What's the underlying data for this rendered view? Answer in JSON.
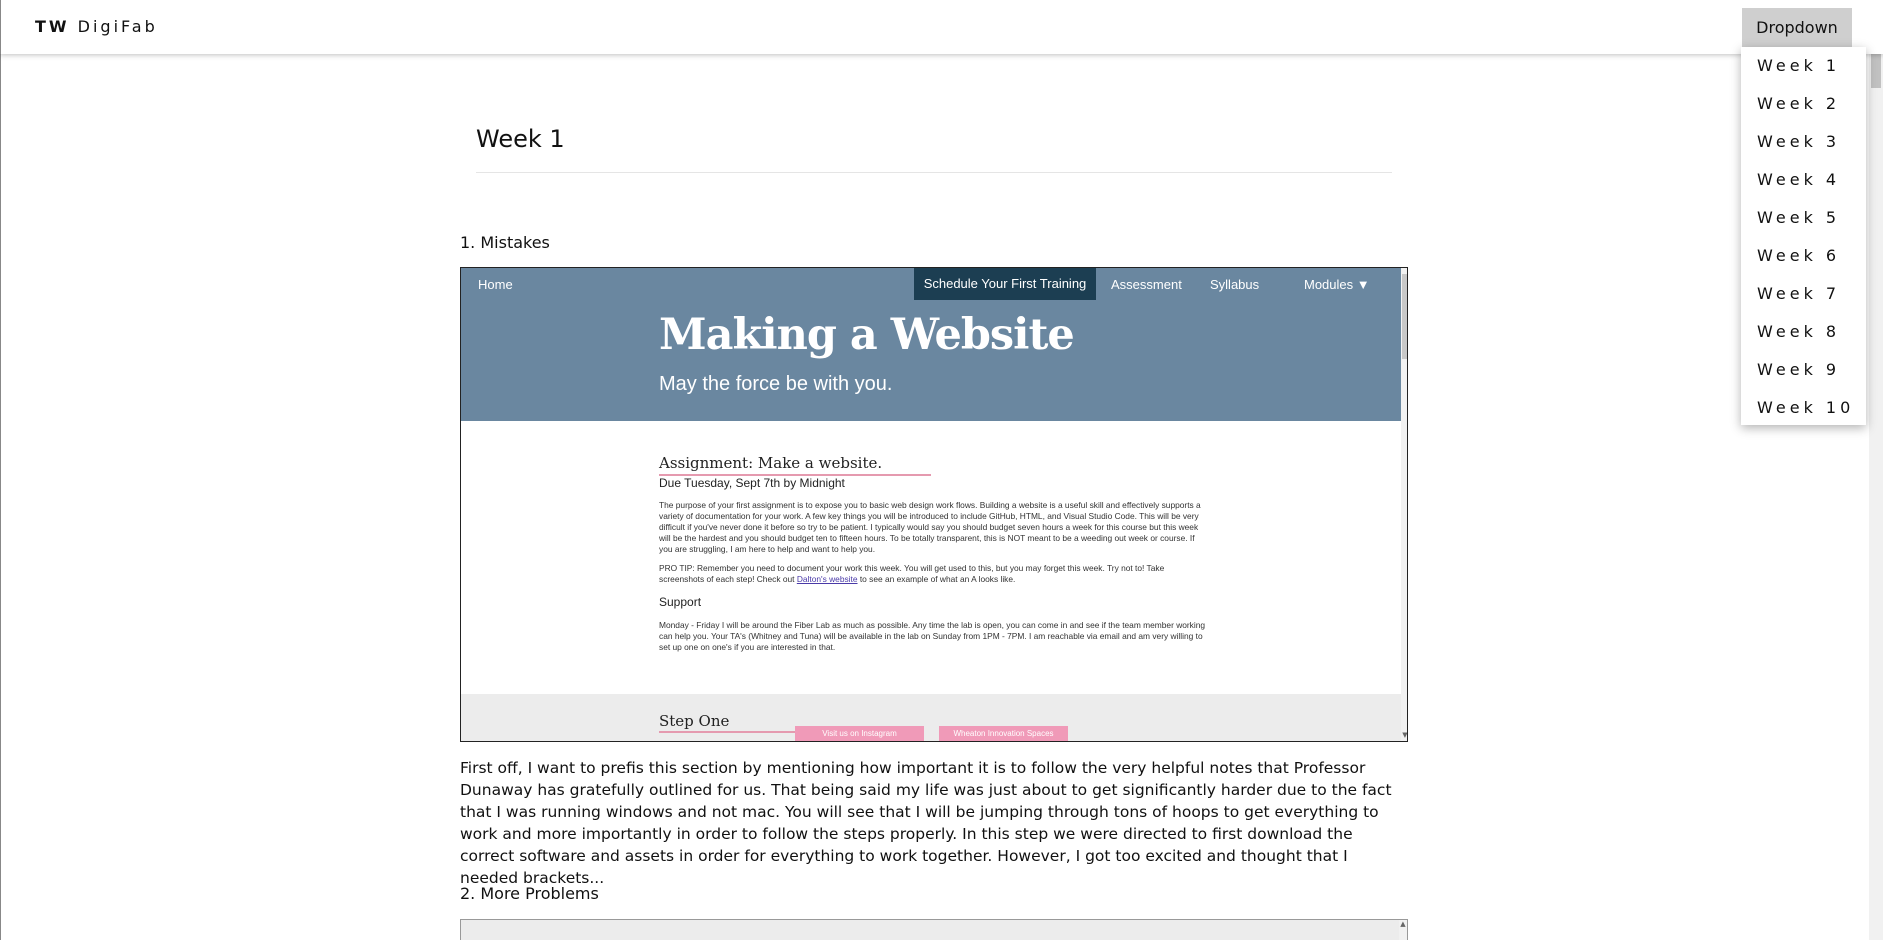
{
  "header": {
    "brand_bold": "TW",
    "brand_rest": "DigiFab",
    "dropdown_label": "Dropdown",
    "dropdown_items": [
      "Week 1",
      "Week 2",
      "Week 3",
      "Week 4",
      "Week 5",
      "Week 6",
      "Week 7",
      "Week 8",
      "Week 9",
      "Week 10"
    ]
  },
  "page": {
    "title": "Week 1",
    "sections": [
      {
        "heading": "1. Mistakes"
      },
      {
        "heading": "2. More Problems"
      }
    ],
    "body_text": "First off, I want to prefis this section by mentioning how important it is to follow the very helpful notes that Professor Dunaway has gratefully outlined for us. That being said my life was just about to get significantly harder due to the fact that I was running windows and not mac. You will see that I will be jumping through tons of hoops to get everything to work and more importantly in order to follow the steps properly. In this step we were directed to first download the correct software and assets in order for everything to work together. However, I got too excited and thought that I needed brackets..."
  },
  "embed": {
    "nav": {
      "home": "Home",
      "cta": "Schedule Your First Training",
      "assessment": "Assessment",
      "syllabus": "Syllabus",
      "modules": "Modules ▼"
    },
    "hero_title": "Making a Website",
    "hero_subtitle": "May the force be with you.",
    "assignment_heading": "Assignment: Make a website.",
    "due": "Due Tuesday, Sept 7th by Midnight",
    "intro_para": "The purpose of your first assignment is to expose you to basic web design work flows. Building a website is a useful skill and effectively supports a variety of documentation for your work. A few key things you will be introduced to include GitHub, HTML, and Visual Studio Code. This will be very difficult if you've never done it before so try to be patient. I typically would say you should budget seven hours a week for this course but this week will be the hardest and you should budget ten to fifteen hours. To be totally transparent, this is NOT meant to be a weeding out week or course. If you are struggling, I am here to help and want to help you.",
    "protip_before": "PRO TIP: Remember you need to document your work this week. You will get used to this, but you may forget this week. Try not to! Take screenshots of each step! Check out ",
    "protip_link": "Dalton's website",
    "protip_after": " to see an example of what an A looks like.",
    "support_heading": "Support",
    "support_para": "Monday - Friday I will be around the Fiber Lab as much as possible. Any time the lab is open, you can come in and see if the team member working can help you. Your TA's (Whitney and Tuna) will be available in the lab on Sunday from 1PM - 7PM. I am reachable via email and am very willing to set up one on one's if you are interested in that.",
    "step_heading": "Step One",
    "pill_instagram": "Visit us on Instagram",
    "pill_wheaton": "Wheaton Innovation Spaces",
    "colors": {
      "hero": "#6a87a0",
      "cta": "#1c3e52",
      "accent_pink": "#e59aaf"
    }
  }
}
